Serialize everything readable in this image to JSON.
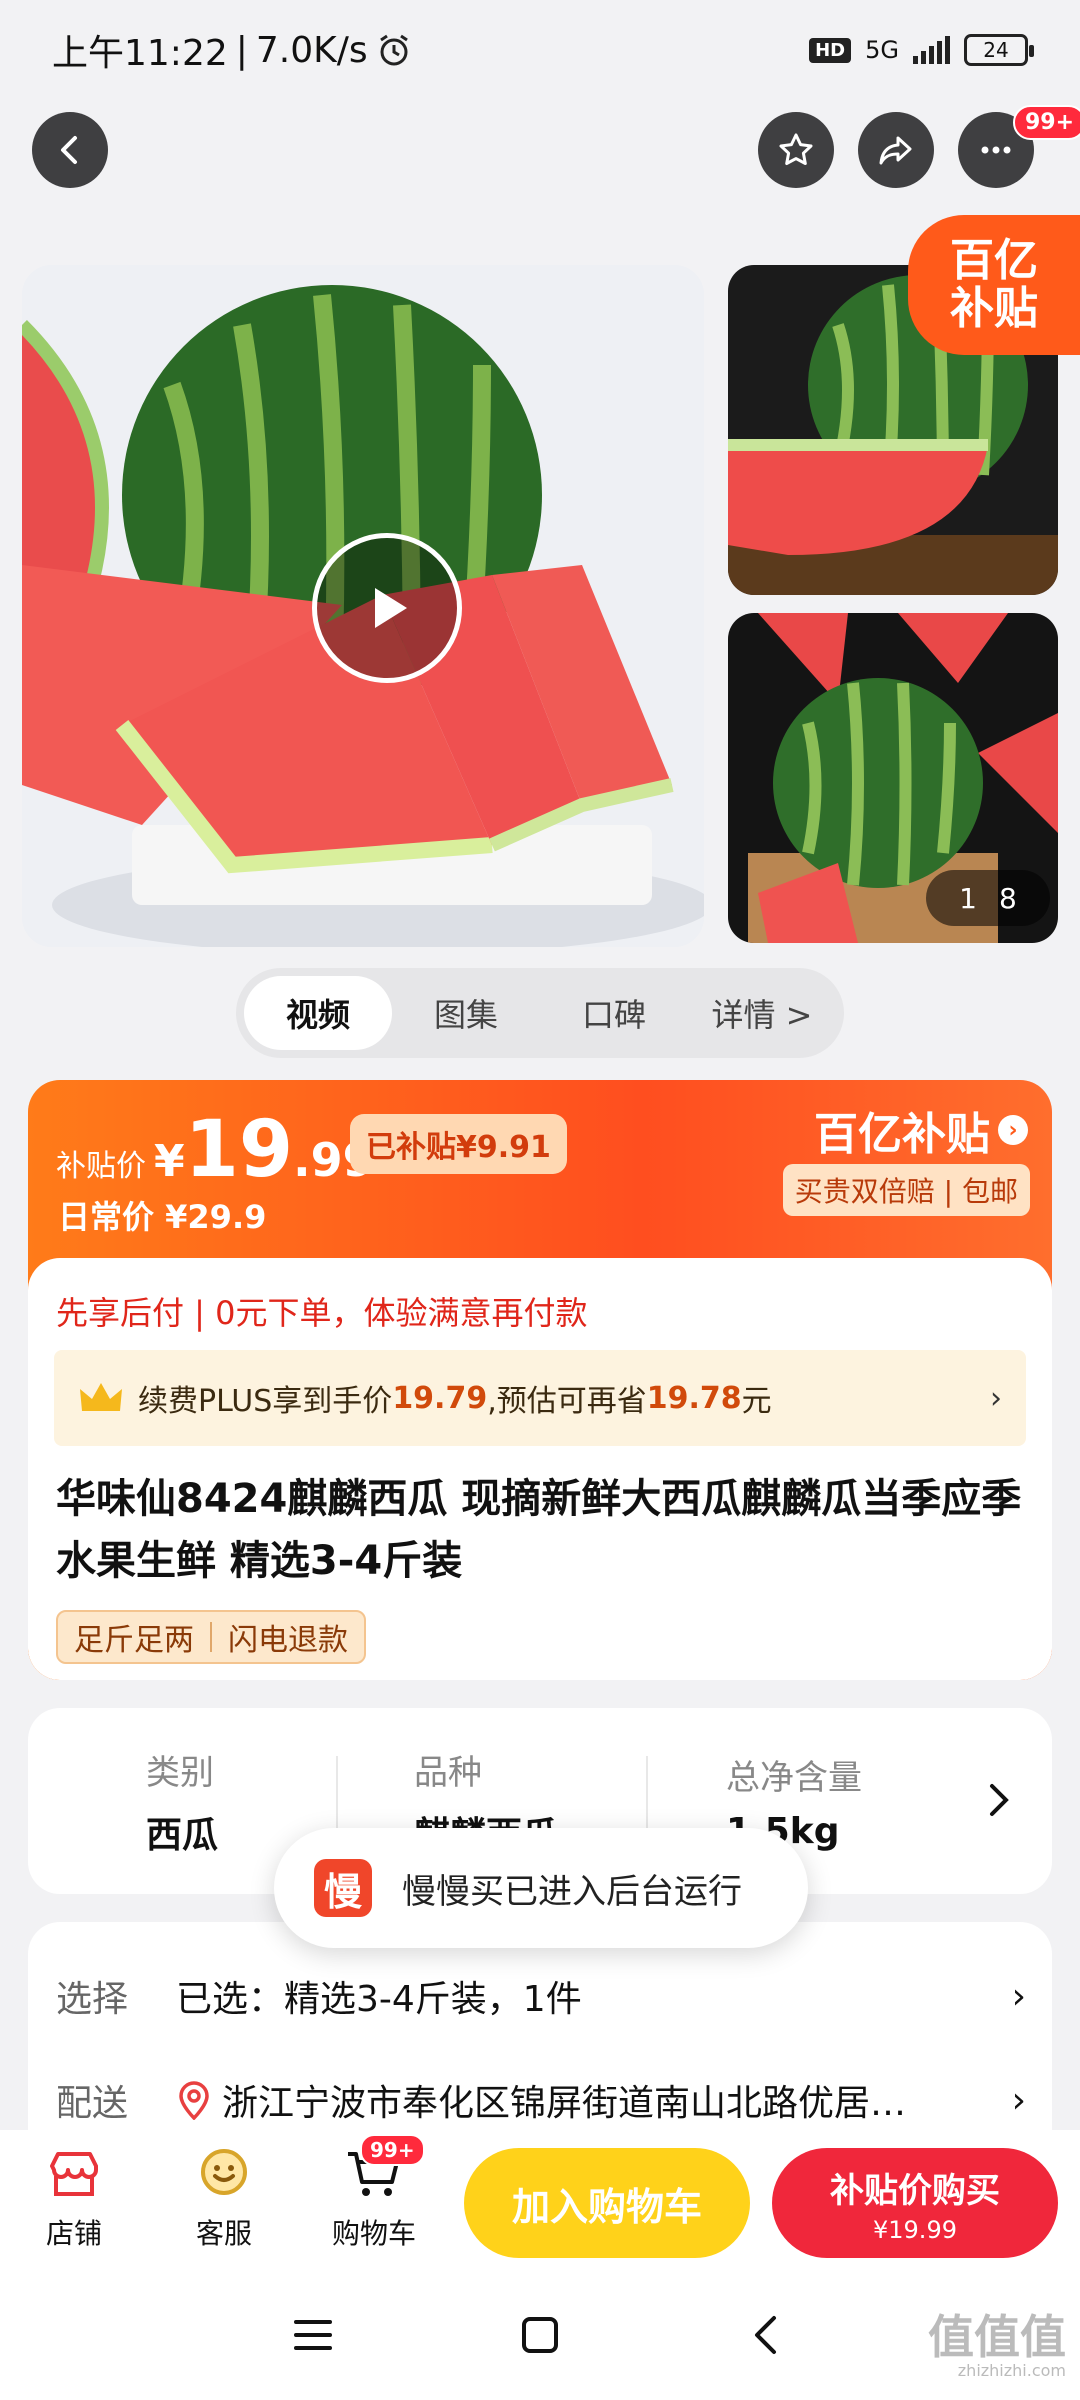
{
  "status_bar": {
    "time": "上午11:22",
    "net_speed": "7.0K/s",
    "hd": "HD",
    "network": "5G",
    "battery": "24"
  },
  "header": {
    "more_badge": "99+"
  },
  "gallery": {
    "counter_current": "1",
    "counter_total": "8",
    "corner_tag_line1": "百亿",
    "corner_tag_line2": "补贴"
  },
  "tabs": [
    {
      "label": "视频",
      "active": true
    },
    {
      "label": "图集",
      "active": false
    },
    {
      "label": "口碑",
      "active": false
    },
    {
      "label": "详情 >",
      "active": false
    }
  ],
  "price": {
    "label": "补贴价",
    "yen": "¥",
    "integer": "19",
    "decimal": ".99",
    "subsidy_pill": "已补贴¥9.91",
    "daily_price": "日常价 ¥29.9",
    "brand": "百亿补贴",
    "brand_sub": "买贵双倍赔 | 包邮"
  },
  "promo": {
    "pay_later": "先享后付 | 0元下单，体验满意再付款",
    "plus_prefix": "续费PLUS享到手价",
    "plus_price": "19.79",
    "plus_mid": ",预估可再省",
    "plus_save": "19.78",
    "plus_suffix": "元",
    "arrow": "›"
  },
  "product": {
    "title": "华味仙8424麒麟西瓜 现摘新鲜大西瓜麒麟瓜当季应季水果生鲜 精选3-4斤装",
    "tags": [
      "足斤足两",
      "闪电退款"
    ]
  },
  "specs": [
    {
      "label": "类别",
      "value": "西瓜"
    },
    {
      "label": "品种",
      "value": "麒麟西瓜"
    },
    {
      "label": "总净含量",
      "value": "1.5kg"
    }
  ],
  "toast": {
    "icon_char": "慢",
    "text": "慢慢买已进入后台运行"
  },
  "selection": {
    "select_label": "选择",
    "select_value": "已选：精选3-4斤装，1件",
    "delivery_label": "配送",
    "delivery_value": "浙江宁波市奉化区锦屏街道南山北路优居…"
  },
  "bottom_bar": {
    "shop": "店铺",
    "service": "客服",
    "cart": "购物车",
    "cart_badge": "99+",
    "add_cart": "加入购物车",
    "buy_line1": "补贴价购买",
    "buy_line2": "¥19.99"
  },
  "watermark": {
    "main": "值值值",
    "sub": "zhizhizhi.com"
  }
}
